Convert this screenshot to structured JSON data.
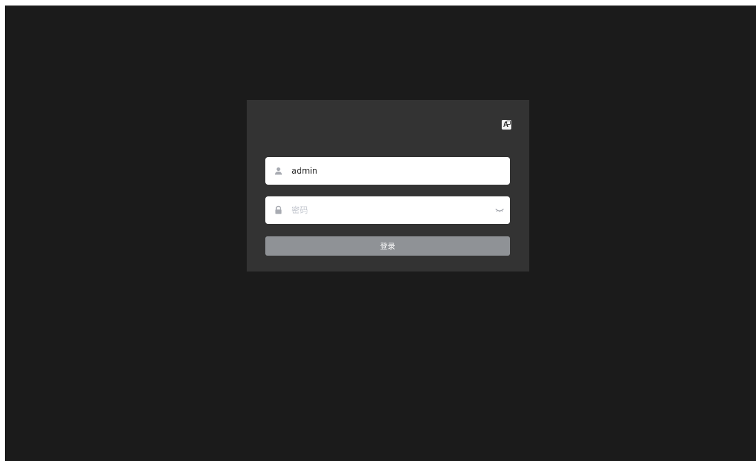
{
  "login": {
    "language_icon": "translate-icon",
    "username": {
      "icon": "user-icon",
      "value": "admin"
    },
    "password": {
      "icon": "lock-icon",
      "placeholder": "密码",
      "value": "",
      "toggle_icon": "eye-closed-icon"
    },
    "submit_label": "登录",
    "colors": {
      "background": "#1b1b1b",
      "card": "#333333",
      "button": "#8f9296"
    }
  }
}
